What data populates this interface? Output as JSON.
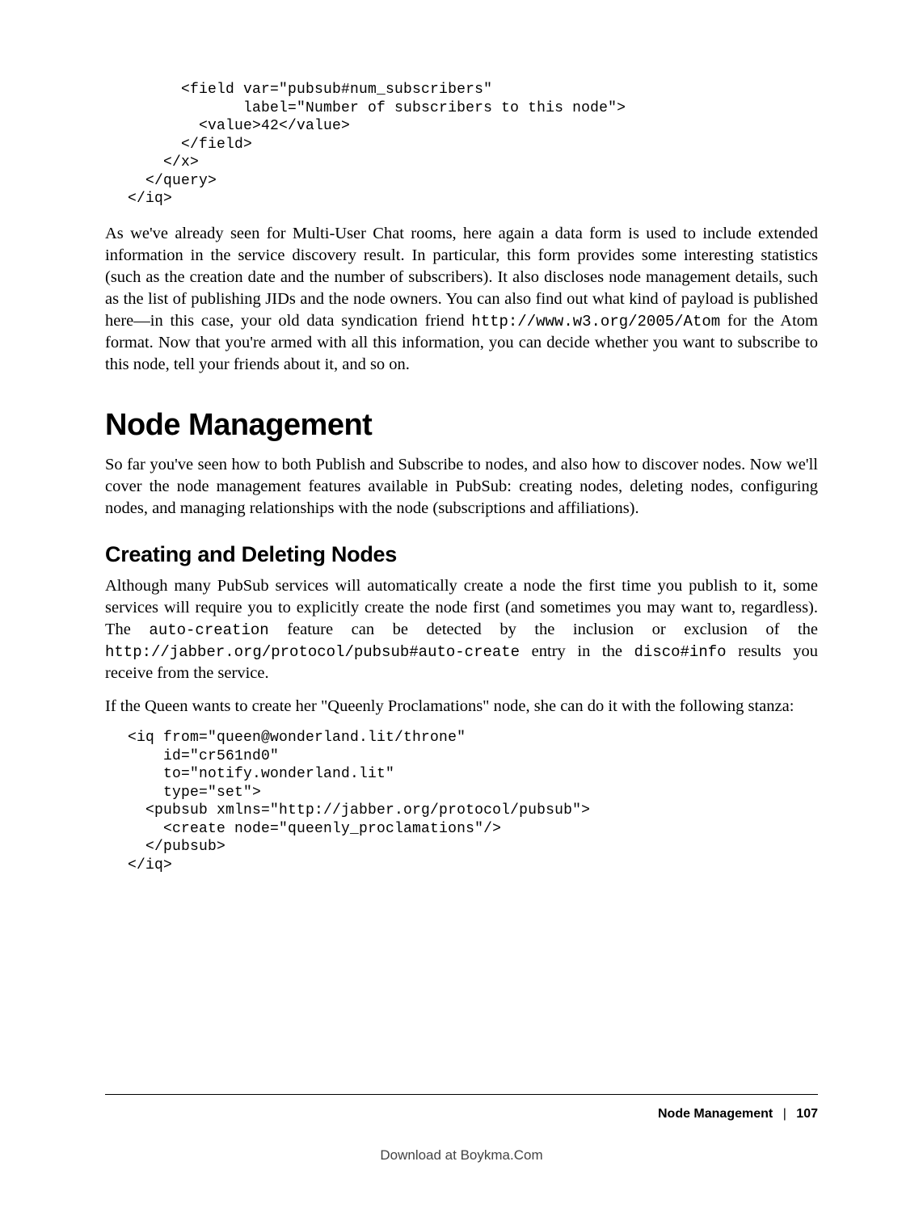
{
  "codeBlock1": "      <field var=\"pubsub#num_subscribers\"\n             label=\"Number of subscribers to this node\">\n        <value>42</value>\n      </field>\n    </x>\n  </query>\n</iq>",
  "para1_a": "As we've already seen for Multi-User Chat rooms, here again a data form is used to include extended information in the service discovery result. In particular, this form provides some interesting statistics (such as the creation date and the number of subscribers). It also discloses node management details, such as the list of publishing JIDs and the node owners. You can also find out what kind of payload is published here—in this case, your old data syndication friend ",
  "para1_mono": "http://www.w3.org/2005/Atom",
  "para1_b": " for the Atom format. Now that you're armed with all this information, you can decide whether you want to subscribe to this node, tell your friends about it, and so on.",
  "heading1": "Node Management",
  "para2": "So far you've seen how to both Publish and Subscribe to nodes, and also how to discover nodes. Now we'll cover the node management features available in PubSub: creating nodes, deleting nodes, configuring nodes, and managing relationships with the node (subscriptions and affiliations).",
  "heading2": "Creating and Deleting Nodes",
  "para3_a": "Although many PubSub services will automatically create a node the first time you publish to it, some services will require you to explicitly create the node first (and sometimes you may want to, regardless). The ",
  "para3_m1": "auto-creation",
  "para3_b": " feature can be detected by the inclusion or exclusion of the ",
  "para3_m2": "http://jabber.org/protocol/pubsub#auto-create",
  "para3_c": " entry in the ",
  "para3_m3": "disco#info",
  "para3_d": " results you receive from the service.",
  "para4": "If the Queen wants to create her \"Queenly Proclamations\" node, she can do it with the following stanza:",
  "codeBlock2": "<iq from=\"queen@wonderland.lit/throne\"\n    id=\"cr561nd0\"\n    to=\"notify.wonderland.lit\"\n    type=\"set\">\n  <pubsub xmlns=\"http://jabber.org/protocol/pubsub\">\n    <create node=\"queenly_proclamations\"/>\n  </pubsub>\n</iq>",
  "footer_section": "Node Management",
  "footer_sep": "|",
  "footer_page": "107",
  "download_line": "Download at Boykma.Com"
}
